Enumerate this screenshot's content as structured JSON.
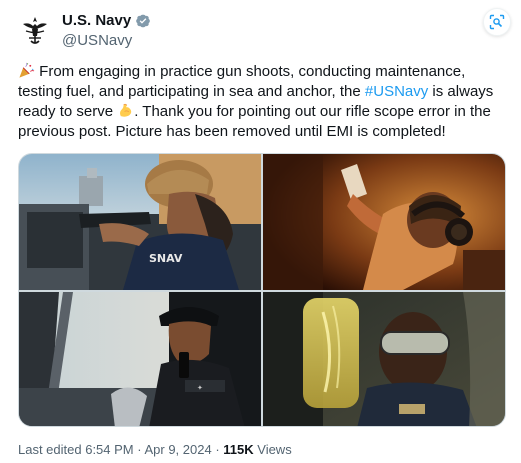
{
  "author": {
    "display_name": "U.S. Navy",
    "handle": "@USNavy",
    "verified_color": "#829aab"
  },
  "post": {
    "text_part1": " From engaging in practice gun shoots, conducting maintenance, testing fuel, and participating in sea and anchor, the ",
    "hashtag": "#USNavy",
    "text_part2": " is always ready to serve ",
    "text_part3": ". Thank you for pointing out our rifle scope error in the previous post. Picture has been removed until EMI is completed!",
    "emoji_1": "party-popper-icon",
    "emoji_2": "flexed-biceps-icon"
  },
  "media": {
    "images": [
      {
        "name": "sailor-gun-shoot-photo",
        "alt": ""
      },
      {
        "name": "sailor-maintenance-photo",
        "alt": ""
      },
      {
        "name": "sailor-bridge-radio-photo",
        "alt": ""
      },
      {
        "name": "sailor-fuel-sample-photo",
        "alt": ""
      }
    ]
  },
  "footer": {
    "edited_prefix": "Last edited ",
    "time": "6:54 PM",
    "separator": " · ",
    "date": "Apr 9, 2024",
    "views_count": "115K",
    "views_label": " Views"
  },
  "colors": {
    "hashtag": "#1d9bf0",
    "muted_text": "#536471",
    "primary_text": "#0f1419"
  }
}
